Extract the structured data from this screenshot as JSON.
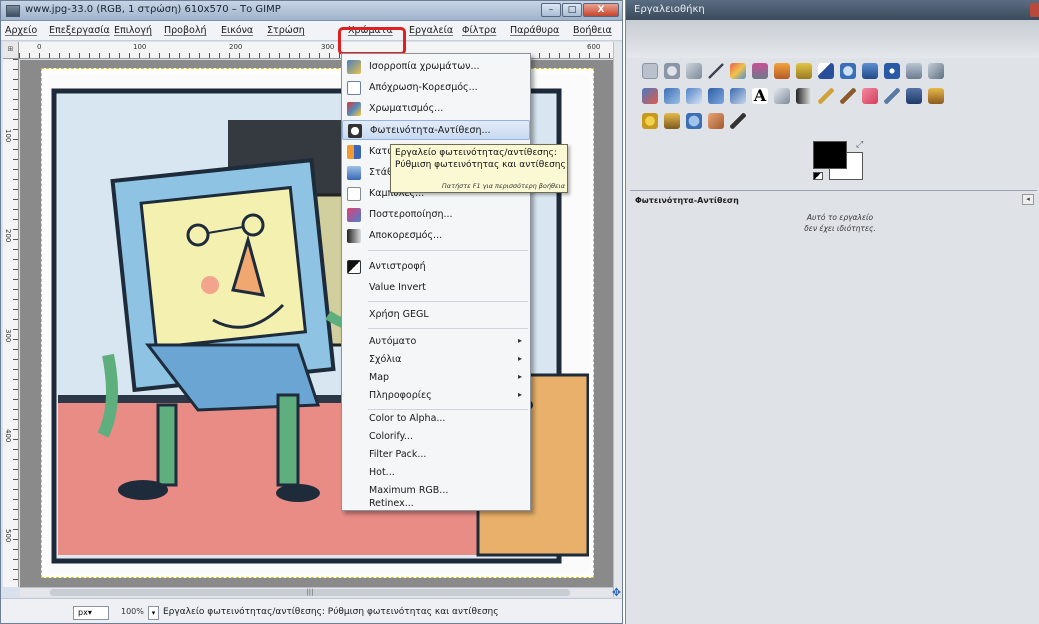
{
  "window": {
    "title": "www.jpg-33.0 (RGB, 1 στρώση) 610x570 – Το GIMP",
    "min_label": "–",
    "max_label": "□",
    "close_label": "X"
  },
  "menubar": {
    "items": [
      "Αρχείο",
      "Επεξεργασία",
      "Επιλογή",
      "Προβολή",
      "Εικόνα",
      "Στρώση",
      "Χρώματα",
      "Εργαλεία",
      "Φίλτρα",
      "Παράθυρα",
      "Βοήθεια"
    ]
  },
  "rulers": {
    "h_ticks": [
      "0",
      "100",
      "200",
      "300",
      "600"
    ],
    "v_ticks": [
      "100",
      "200",
      "300",
      "400",
      "500"
    ]
  },
  "colors_menu": {
    "items": [
      {
        "label": "Ισορροπία χρωμάτων...",
        "icon": "color-balance-icon",
        "submenu": false
      },
      {
        "label": "Απόχρωση-Κορεσμός...",
        "icon": "hue-saturation-icon",
        "submenu": false
      },
      {
        "label": "Χρωματισμός...",
        "icon": "colorize-icon",
        "submenu": false
      },
      {
        "label": "Φωτεινότητα-Αντίθεση...",
        "icon": "brightness-contrast-icon",
        "submenu": false
      },
      {
        "label": "Κατω",
        "icon": "threshold-icon",
        "submenu": false
      },
      {
        "label": "Στάθ",
        "icon": "levels-icon",
        "submenu": false
      },
      {
        "label": "Καμπύλες...",
        "icon": "curves-icon",
        "submenu": false
      },
      {
        "label": "Ποστεροποίηση...",
        "icon": "posterize-icon",
        "submenu": false
      },
      {
        "label": "Αποκορεσμός...",
        "icon": "desaturate-icon",
        "submenu": false
      },
      {
        "label": "Αντιστροφή",
        "icon": "invert-icon",
        "submenu": false
      },
      {
        "label": "Value Invert",
        "icon": "",
        "submenu": false
      },
      {
        "label": "Χρήση GEGL",
        "icon": "",
        "submenu": false
      },
      {
        "label": "Αυτόματο",
        "icon": "",
        "submenu": true
      },
      {
        "label": "Σχόλια",
        "icon": "",
        "submenu": true
      },
      {
        "label": "Map",
        "icon": "",
        "submenu": true
      },
      {
        "label": "Πληροφορίες",
        "icon": "",
        "submenu": true
      },
      {
        "label": "Color to Alpha...",
        "icon": "",
        "submenu": false
      },
      {
        "label": "Colorify...",
        "icon": "",
        "submenu": false
      },
      {
        "label": "Filter Pack...",
        "icon": "",
        "submenu": false
      },
      {
        "label": "Hot...",
        "icon": "",
        "submenu": false
      },
      {
        "label": "Maximum RGB...",
        "icon": "",
        "submenu": false
      },
      {
        "label": "Retinex...",
        "icon": "",
        "submenu": false
      }
    ],
    "highlighted_index": 3
  },
  "tooltip": {
    "title": "Εργαλείο φωτεινότητας/αντίθεσης:",
    "description": "Ρύθμιση φωτεινότητας και αντίθεσης",
    "hint": "Πατήστε F1 για περισσότερη βοήθεια"
  },
  "statusbar": {
    "unit": "px",
    "zoom": "100%",
    "message": "Εργαλείο φωτεινότητας/αντίθεσης: Ρύθμιση φωτεινότητας και αντίθεσης"
  },
  "toolbox": {
    "title": "Εργαλειοθήκη",
    "tool_options_title": "Φωτεινότητα-Αντίθεση",
    "tool_options_message_1": "Αυτό το εργαλείο",
    "tool_options_message_2": "δεν έχει ιδιότητες.",
    "fg_color": "#000000",
    "bg_color": "#ffffff"
  },
  "accent": {
    "highlight_border": "#e02020",
    "menu_hover": "#c9daf1",
    "tooltip_bg": "#fbf9d4"
  }
}
